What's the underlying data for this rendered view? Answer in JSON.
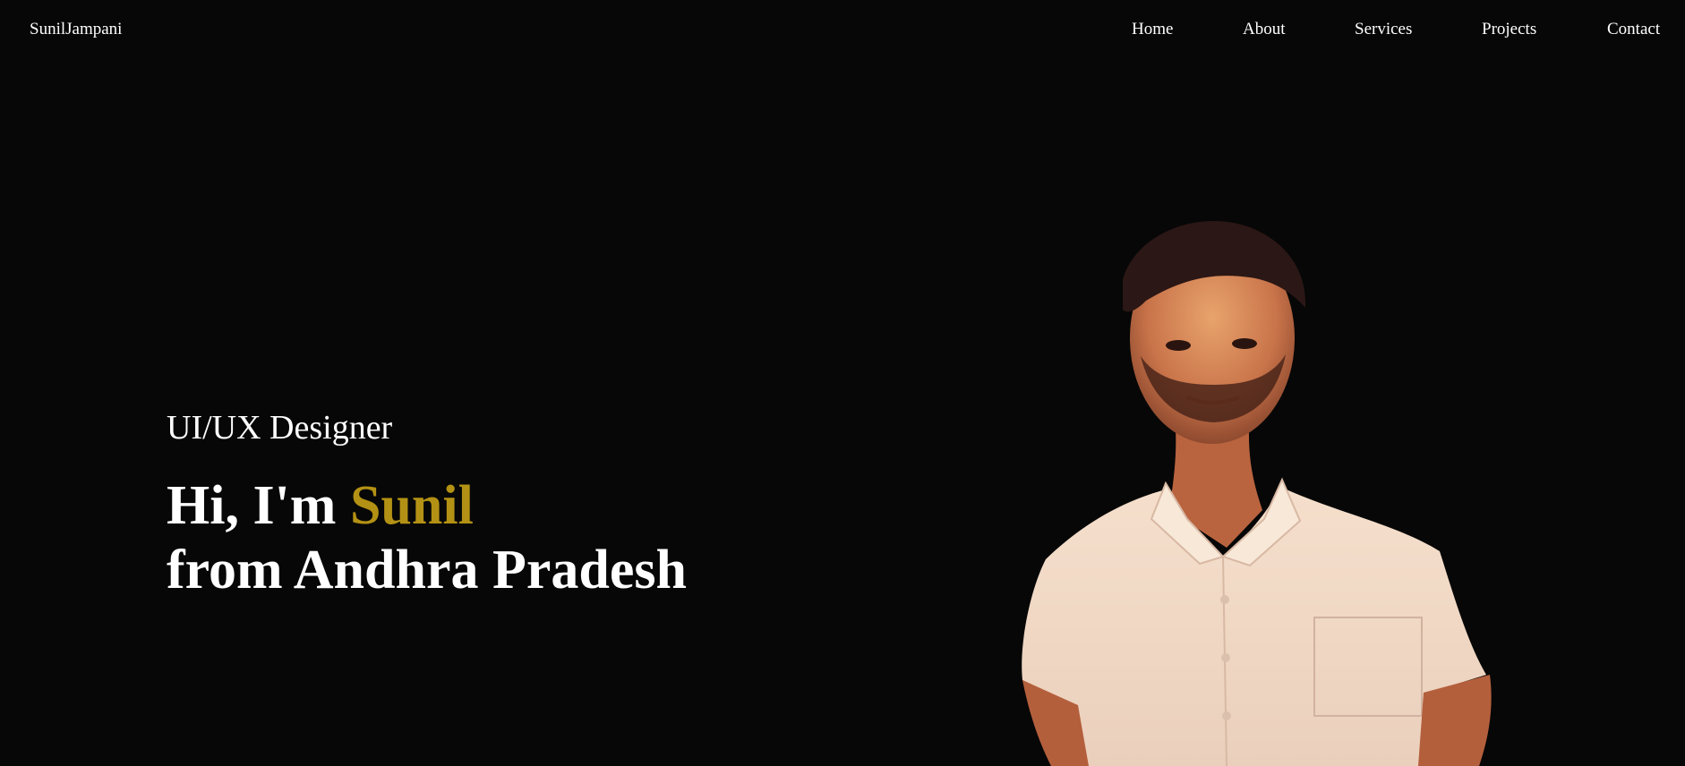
{
  "header": {
    "logo": "SunilJampani",
    "nav": [
      "Home",
      "About",
      "Services",
      "Projects",
      "Contact"
    ]
  },
  "hero": {
    "role": "UI/UX Designer",
    "greeting": "Hi, I'm",
    "name": "Sunil",
    "line2": "from Andhra Pradesh"
  },
  "colors": {
    "background": "#070707",
    "text": "#ffffff",
    "accent": "#b39114"
  },
  "icons": {
    "portrait": "person-photo"
  }
}
